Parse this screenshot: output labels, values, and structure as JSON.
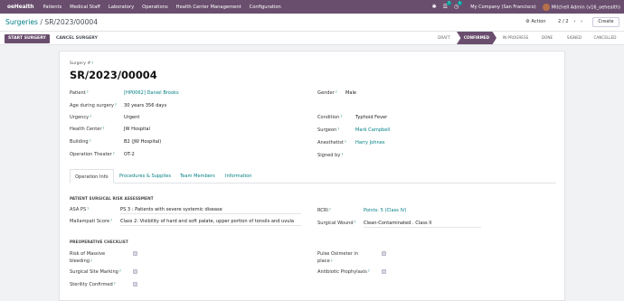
{
  "topbar": {
    "app_name": "oeHealth",
    "menus": [
      "Patients",
      "Medical Staff",
      "Laboratory",
      "Operations",
      "Health Center Management",
      "Configuration"
    ],
    "messages_count": "7",
    "activity_count": "1",
    "company": "My Company (San Francisco)",
    "user": "Mitchell Admin (v16_oehealth)"
  },
  "control": {
    "breadcrumb_parent": "Surgeries",
    "breadcrumb_sep": " / ",
    "breadcrumb_current": "SR/2023/00004",
    "action_label": "Action",
    "pager": "2 / 2",
    "create_label": "Create"
  },
  "statusbar": {
    "start_label": "START SURGERY",
    "cancel_label": "CANCEL SURGERY",
    "stages": [
      "DRAFT",
      "CONFIRMED",
      "IN PROGRESS",
      "DONE",
      "SIGNED",
      "CANCELLED"
    ],
    "active_stage": "CONFIRMED"
  },
  "form": {
    "surgery_number_label": "Surgery #",
    "surgery_number": "SR/2023/00004",
    "left_fields": [
      {
        "label": "Patient",
        "value": "[HP0062] Daniel Brooks",
        "link": true
      },
      {
        "label": "Age during surgery",
        "value": "30 years 356 days",
        "link": false
      },
      {
        "label": "Urgency",
        "value": "Urgent",
        "link": false
      },
      {
        "label": "Health Center",
        "value": "JW Hospital",
        "link": false
      },
      {
        "label": "Building",
        "value": "B2 (JW Hospital)",
        "link": false
      },
      {
        "label": "Operation Theater",
        "value": "OT-2",
        "link": false
      }
    ],
    "right_fields": [
      {
        "label": "Gender",
        "value": "Male",
        "link": false
      },
      {
        "label": "Condition",
        "value": "Typhoid Fever",
        "link": false
      },
      {
        "label": "Surgeon",
        "value": "Mark Campbell",
        "link": true
      },
      {
        "label": "Anesthetist",
        "value": "Harry Johnes",
        "link": true
      },
      {
        "label": "Signed by",
        "value": "",
        "link": false
      }
    ],
    "tabs": [
      "Operation Info",
      "Procedures & Supplies",
      "Team Members",
      "Information"
    ],
    "active_tab": "Operation Info",
    "risk_section": "PATIENT SURGICAL RISK ASSESSMENT",
    "asa_label": "ASA PS",
    "asa_value": "PS 3 : Patients with severe systemic disease",
    "mallampati_label": "Mallampati Score",
    "mallampati_value": "Class 2: Visibility of hard and soft palate, upper portion of tonsils and uvula",
    "rcri_label": "RCRI",
    "rcri_value": "Points: 5 (Class IV)",
    "wound_label": "Surgical Wound",
    "wound_value": "Clean-Contaminated . Class II",
    "checklist_section": "PREOPERATIVE CHECKLIST",
    "checklist_left": [
      "Risk of Massive bleeding",
      "Surgical Site Marking",
      "Sterility Confirmed"
    ],
    "checklist_right": [
      "Pulse Oximeter in place",
      "Antibiotic Prophylaxis"
    ]
  },
  "colors": {
    "brand": "#6a4e6e",
    "link": "#017e84"
  },
  "icons": [
    "bug-icon",
    "chat-icon",
    "clock-icon",
    "gear-icon",
    "chevron-left-icon",
    "chevron-right-icon"
  ]
}
